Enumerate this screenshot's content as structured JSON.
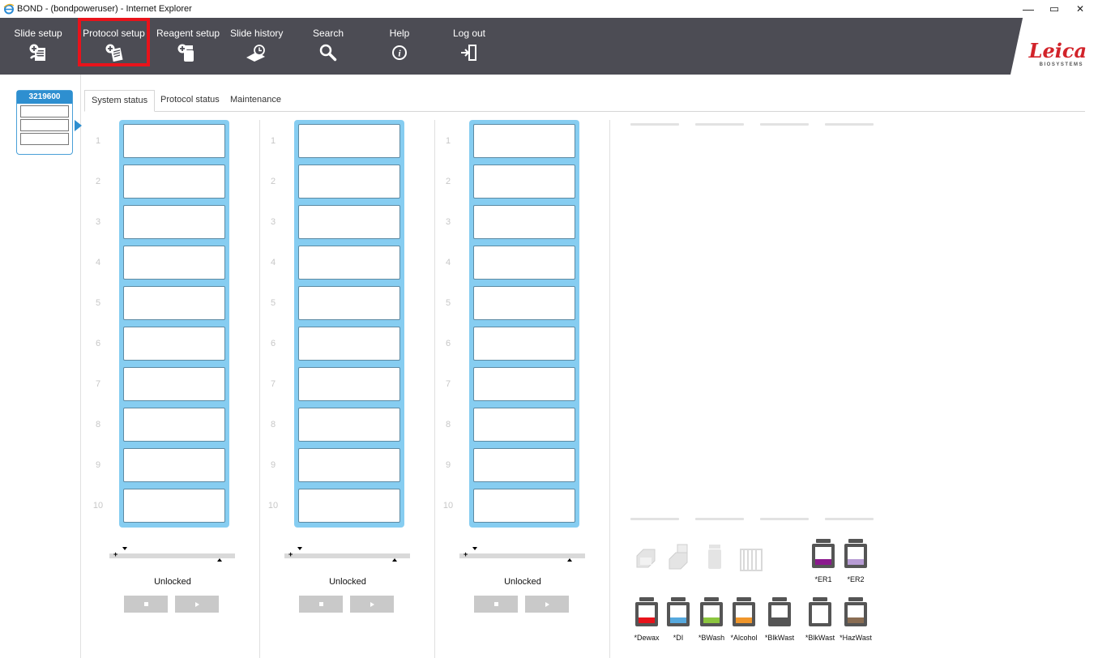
{
  "window": {
    "title": "BOND - (bondpoweruser) - Internet Explorer",
    "minimize": "—",
    "restore": "▭",
    "close": "✕"
  },
  "nav": {
    "items": [
      {
        "label": "Slide setup",
        "icon": "slide-setup-icon"
      },
      {
        "label": "Protocol setup",
        "icon": "protocol-setup-icon",
        "selected": true
      },
      {
        "label": "Reagent setup",
        "icon": "reagent-setup-icon"
      },
      {
        "label": "Slide history",
        "icon": "slide-history-icon"
      },
      {
        "label": "Search",
        "icon": "search-icon"
      },
      {
        "label": "Help",
        "icon": "help-icon"
      },
      {
        "label": "Log out",
        "icon": "logout-icon"
      }
    ],
    "highlight_color": "#e8131b",
    "bar_color": "#4c4c54"
  },
  "logo": {
    "name": "Leica",
    "sub": "BIOSYSTEMS",
    "color": "#d2232a"
  },
  "instrument": {
    "id": "3219600",
    "accent": "#2e8fd0"
  },
  "tabs": [
    {
      "label": "System status",
      "active": true
    },
    {
      "label": "Protocol status"
    },
    {
      "label": "Maintenance"
    }
  ],
  "trays": [
    {
      "status": "Unlocked",
      "slots": [
        "1",
        "2",
        "3",
        "4",
        "5",
        "6",
        "7",
        "8",
        "9",
        "10"
      ]
    },
    {
      "status": "Unlocked",
      "slots": [
        "1",
        "2",
        "3",
        "4",
        "5",
        "6",
        "7",
        "8",
        "9",
        "10"
      ]
    },
    {
      "status": "Unlocked",
      "slots": [
        "1",
        "2",
        "3",
        "4",
        "5",
        "6",
        "7",
        "8",
        "9",
        "10"
      ]
    }
  ],
  "rack_color": "#86cdf1",
  "bulk_top": [
    {
      "label": "*ER1",
      "color": "#8b1a8e"
    },
    {
      "label": "*ER2",
      "color": "#b79bd4"
    }
  ],
  "bulk_bottom": [
    {
      "label": "*Dewax",
      "color": "#e8131b"
    },
    {
      "label": "*DI",
      "color": "#56a9de"
    },
    {
      "label": "*BWash",
      "color": "#8cc63f"
    },
    {
      "label": "*Alcohol",
      "color": "#f0962b"
    },
    {
      "label": "*BlkWast",
      "color": "#555555"
    },
    {
      "label": "*BlkWast",
      "color": "#ffffff"
    },
    {
      "label": "*HazWast",
      "color": "#8a6d53"
    }
  ]
}
